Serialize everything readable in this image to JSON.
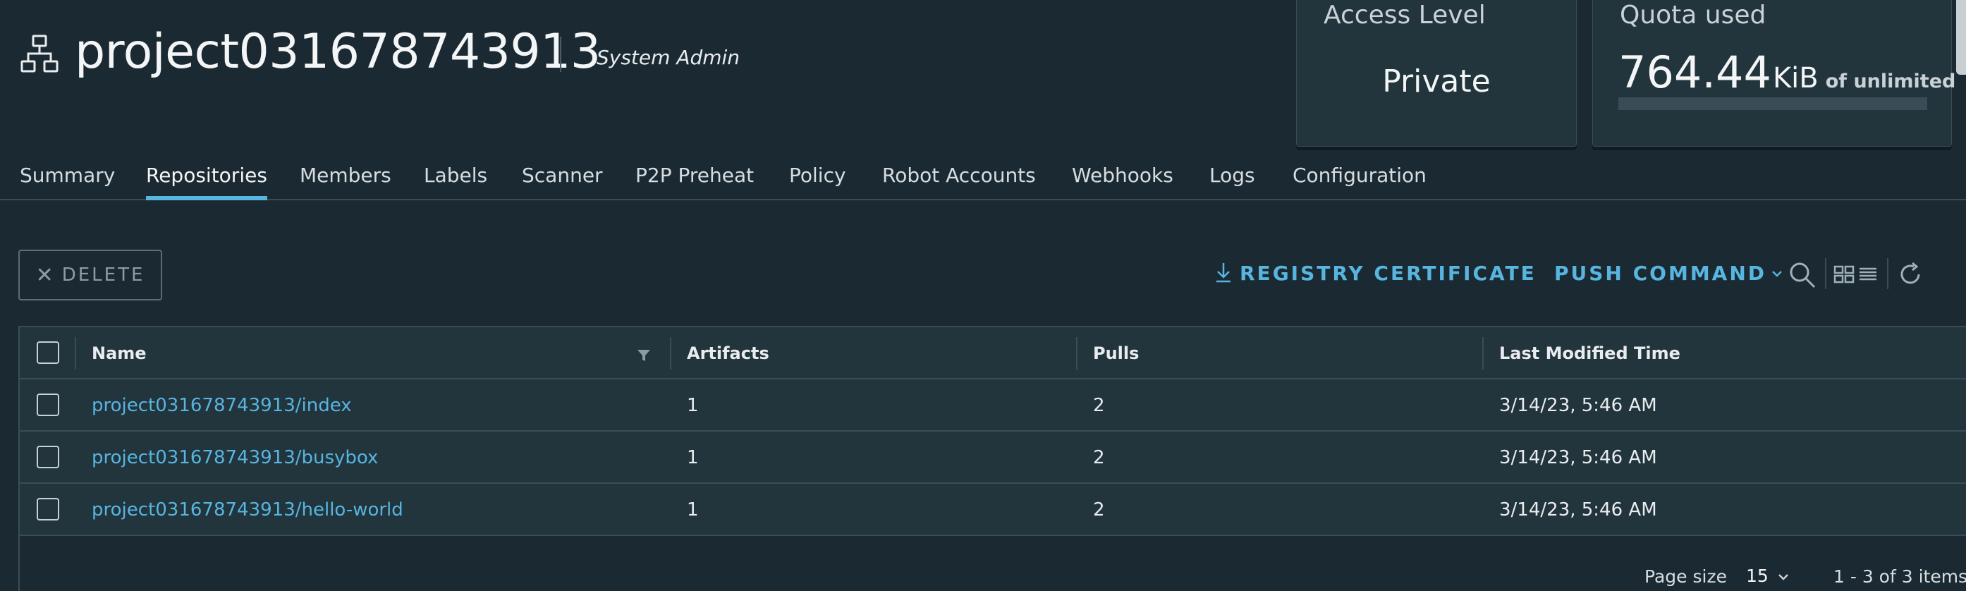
{
  "header": {
    "project_name": "project031678743913",
    "role": "System Admin",
    "project_icon": "project-hierarchy-icon"
  },
  "cards": {
    "access": {
      "label": "Access Level",
      "value": "Private"
    },
    "quota": {
      "label": "Quota used",
      "amount": "764.44",
      "unit": "KiB",
      "suffix": "of unlimited",
      "usage_fraction": 0
    }
  },
  "tabs": [
    {
      "label": "Summary",
      "active": false
    },
    {
      "label": "Repositories",
      "active": true
    },
    {
      "label": "Members",
      "active": false
    },
    {
      "label": "Labels",
      "active": false
    },
    {
      "label": "Scanner",
      "active": false
    },
    {
      "label": "P2P Preheat",
      "active": false
    },
    {
      "label": "Policy",
      "active": false
    },
    {
      "label": "Robot Accounts",
      "active": false
    },
    {
      "label": "Webhooks",
      "active": false
    },
    {
      "label": "Logs",
      "active": false
    },
    {
      "label": "Configuration",
      "active": false
    }
  ],
  "toolbar": {
    "delete_label": "DELETE",
    "registry_cert_label": "REGISTRY CERTIFICATE",
    "push_command_label": "PUSH COMMAND",
    "icons": [
      "download-icon",
      "chevron-down-icon",
      "search-icon",
      "card-view-icon",
      "list-view-icon",
      "refresh-icon"
    ]
  },
  "table": {
    "columns": [
      "Name",
      "Artifacts",
      "Pulls",
      "Last Modified Time"
    ],
    "rows": [
      {
        "name": "project031678743913/index",
        "artifacts": "1",
        "pulls": "2",
        "modified": "3/14/23, 5:46 AM"
      },
      {
        "name": "project031678743913/busybox",
        "artifacts": "1",
        "pulls": "2",
        "modified": "3/14/23, 5:46 AM"
      },
      {
        "name": "project031678743913/hello-world",
        "artifacts": "1",
        "pulls": "2",
        "modified": "3/14/23, 5:46 AM"
      }
    ],
    "footer": {
      "page_size_label": "Page size",
      "page_size_value": "15",
      "items_text": "1 - 3 of 3 items"
    }
  },
  "colors": {
    "background": "#1b2a32",
    "surface": "#22343c",
    "accent": "#57b5e0",
    "border": "#3a4c55"
  }
}
